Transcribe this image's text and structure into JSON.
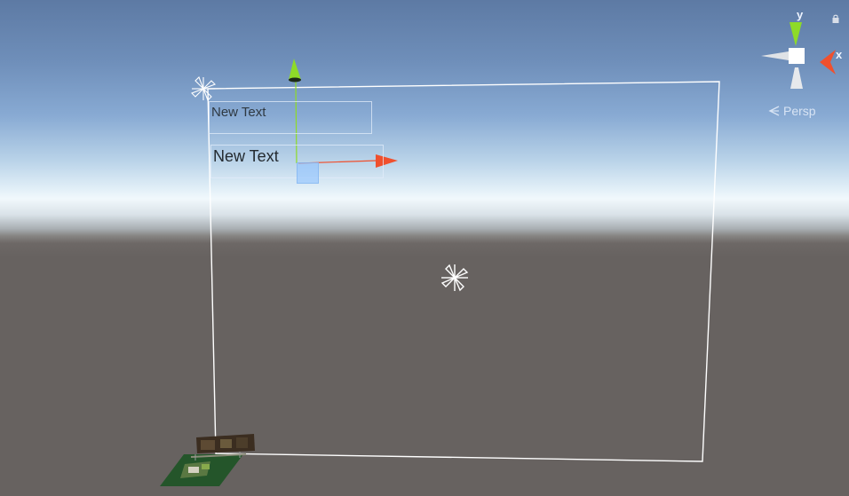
{
  "scene_view": {
    "canvas_text_1": "New Text",
    "canvas_text_2": "New Text"
  },
  "orientation_gizmo": {
    "y_label": "y",
    "x_label": "x",
    "projection_label": "Persp"
  },
  "icons": {
    "canvas_anchor": "canvas-anchor-icon",
    "center_pivot": "pivot-icon",
    "lock": "lock-icon",
    "persp": "perspective-icon"
  },
  "colors": {
    "y_axis": "#8edb28",
    "x_axis": "#f0502e",
    "selection": "#ffffff",
    "move_plane": "#91c3ff"
  }
}
